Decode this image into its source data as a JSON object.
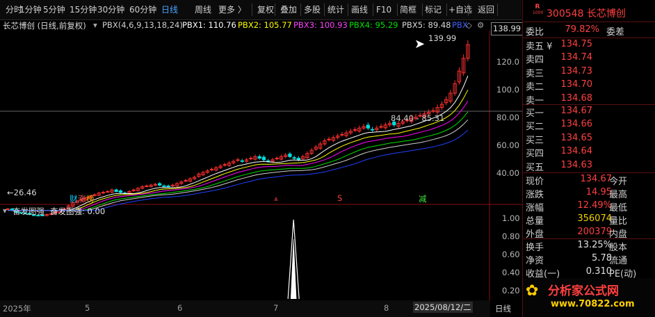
{
  "toolbar": {
    "items": [
      "分时",
      "1分钟",
      "5分钟",
      "15分钟",
      "30分钟",
      "60分钟",
      "日线",
      "周线",
      "更多 〉",
      "复权",
      "叠加",
      "多股",
      "统计",
      "画线",
      "F10",
      "简框",
      "标记",
      "+自选",
      "返回"
    ],
    "active": "日线"
  },
  "chart": {
    "title": "长芯博创 (日线,前复权)",
    "indicator_name": "PBX(4,6,9,13,18,24)",
    "pbx1": "PBX1: 110.76",
    "pbx2": "PBX2: 105.77",
    "pbx3": "PBX3: 100.93",
    "pbx4": "PBX4: 95.29",
    "pbx5": "PBX5: 89.48",
    "pbx6": "PBX",
    "high_label": "139.99",
    "low_label": "←26.46",
    "mid_label": "84.40 - 85.31",
    "current_axis_label": "138.99",
    "y_ticks": [
      "120.0",
      "100.0",
      "80.00",
      "60.00",
      "40.00"
    ],
    "sub_ticks": [
      "1.00",
      "0.80",
      "0.60",
      "0.40",
      "0.20"
    ],
    "event_labels": [
      "财",
      "涨",
      "榜",
      "S",
      "减"
    ],
    "sub_title": "奋发图强",
    "sub_value": "奋发图强: 0.00",
    "dates": [
      "2025年",
      "5",
      "6",
      "7",
      "8",
      "2025/08/12/二"
    ],
    "bottom_right": "日线",
    "colors": {
      "pbx1": "#ffffff",
      "pbx2": "#ffff00",
      "pbx3": "#ff00ff",
      "pbx4": "#00e000",
      "pbx5": "#d0d0d0",
      "pbx6": "#2040ff",
      "up": "#ff3030",
      "down": "#00e0e0"
    }
  },
  "quote": {
    "code_name": "300548 长芯博创",
    "badge_top": "R",
    "badge_bottom": "1000",
    "weibi_label": "委比",
    "weibi_value": "79.82%",
    "weicha_label": "委差",
    "asks": [
      {
        "label": "卖五 ¥",
        "price": "134.75"
      },
      {
        "label": "卖四",
        "price": "134.74"
      },
      {
        "label": "卖三",
        "price": "134.73"
      },
      {
        "label": "卖二",
        "price": "134.70"
      },
      {
        "label": "卖一",
        "price": "134.68"
      }
    ],
    "bids": [
      {
        "label": "买一",
        "price": "134.67"
      },
      {
        "label": "买二",
        "price": "134.66"
      },
      {
        "label": "买三",
        "price": "134.65"
      },
      {
        "label": "买四",
        "price": "134.64"
      },
      {
        "label": "买五",
        "price": "134.63"
      }
    ],
    "stats": [
      {
        "k": "现价",
        "v": "134.67",
        "k2": "今开",
        "cls": "red"
      },
      {
        "k": "涨跌",
        "v": "14.95",
        "k2": "最高",
        "cls": "red"
      },
      {
        "k": "涨幅",
        "v": "12.49%",
        "k2": "最低",
        "cls": "red"
      },
      {
        "k": "总量",
        "v": "356074",
        "k2": "量比",
        "cls": "yel"
      },
      {
        "k": "外盘",
        "v": "200379",
        "k2": "内盘",
        "cls": "red"
      }
    ],
    "stats2": [
      {
        "k": "换手",
        "v": "13.25%",
        "k2": "股本"
      },
      {
        "k": "净资",
        "v": "5.78",
        "k2": "流通"
      },
      {
        "k": "收益(一)",
        "v": "0.310",
        "k2": "PE(动)"
      }
    ],
    "watermark_title": "分析家公式网",
    "watermark_url": "www.70822.com"
  },
  "chart_data": {
    "type": "candlestick",
    "price_axis": [
      40,
      140
    ],
    "closes": [
      31,
      30,
      29,
      28.5,
      28,
      27.5,
      27,
      26.8,
      27,
      27.5,
      28,
      29,
      30,
      31,
      33,
      35,
      36,
      37,
      38,
      39,
      40,
      41,
      41.5,
      42,
      43,
      42,
      41.5,
      41,
      42,
      43,
      44,
      45,
      45.5,
      46,
      46.5,
      46,
      45.5,
      45,
      46,
      47,
      48,
      49,
      50,
      51,
      53,
      54,
      55,
      56,
      57,
      58,
      59,
      60,
      61,
      62,
      61,
      62,
      63,
      64,
      63,
      62,
      61,
      62,
      63,
      64,
      65,
      64,
      63,
      62,
      64,
      66,
      68,
      70,
      72,
      74,
      75,
      76,
      77,
      78,
      79,
      80,
      81,
      82,
      83,
      82,
      81,
      82,
      83,
      84,
      85,
      84,
      85,
      86,
      87,
      88,
      89,
      90,
      91,
      92,
      93,
      95,
      97,
      100,
      104,
      110,
      118,
      126,
      134.67
    ],
    "signal_peak": {
      "x_frac": 0.62,
      "value": 1.0
    }
  }
}
